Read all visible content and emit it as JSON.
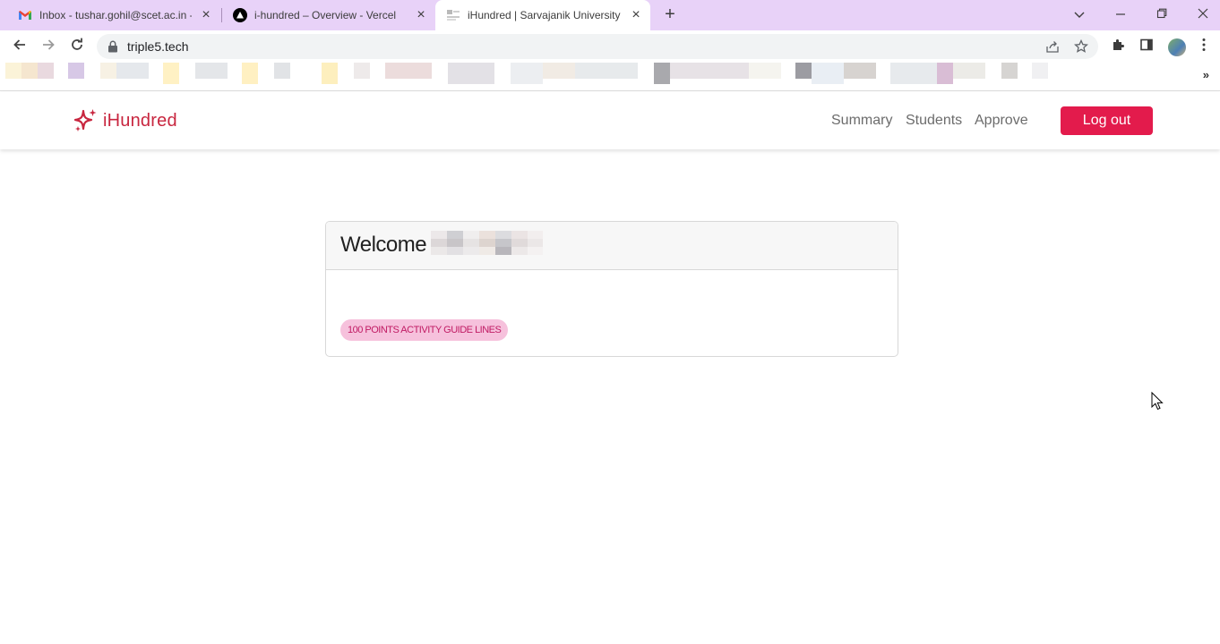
{
  "browser": {
    "tabs": [
      {
        "title": "Inbox - tushar.gohil@scet.ac.in -",
        "favicon": "gmail-icon",
        "active": false
      },
      {
        "title": "i-hundred – Overview - Vercel",
        "favicon": "vercel-icon",
        "active": false
      },
      {
        "title": "iHundred | Sarvajanik University",
        "favicon": "site-icon",
        "active": true
      }
    ],
    "new_tab": "+",
    "url": "triple5.tech",
    "bookmarks_overflow": "»"
  },
  "app": {
    "brand": "iHundred",
    "brand_color": "#c8263f",
    "nav": {
      "summary": "Summary",
      "students": "Students",
      "approve": "Approve",
      "logout": "Log out"
    },
    "accent_color": "#e31b4c"
  },
  "card": {
    "welcome": "Welcome",
    "badge": "100 POINTS ACTIVITY GUIDE LINES",
    "badge_bg": "#f6c1dc",
    "badge_color": "#c01a63"
  }
}
